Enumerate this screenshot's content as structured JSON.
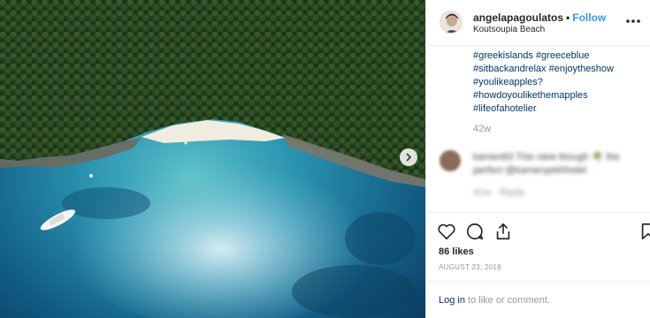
{
  "post": {
    "username": "angelapagoulatos",
    "separator": "•",
    "follow_label": "Follow",
    "location": "Koutsoupia Beach",
    "hashtags": [
      "#greekislands #greeceblue",
      "#sitbackandrelax #enjoytheshow",
      "#youlikeapples?",
      "#howdoyoulikethemapples",
      "#lifeofahotelier"
    ],
    "time_ago": "42w",
    "blurred_comment": {
      "line1": "kamen83 This view though 🌴 the",
      "line2": "perfect @kamenyekhhotel",
      "meta": "41w · Reply"
    },
    "likes": "86 likes",
    "date": "AUGUST 23, 2018",
    "login_link": "Log in",
    "login_rest": " to like or comment."
  },
  "icons": {
    "next": "chevron-right-icon",
    "more": "more-horizontal-icon",
    "like": "heart-icon",
    "comment": "comment-icon",
    "share": "share-icon",
    "save": "bookmark-icon"
  },
  "colors": {
    "link_blue": "#3897f0",
    "hashtag": "#003569",
    "muted": "#999999"
  }
}
